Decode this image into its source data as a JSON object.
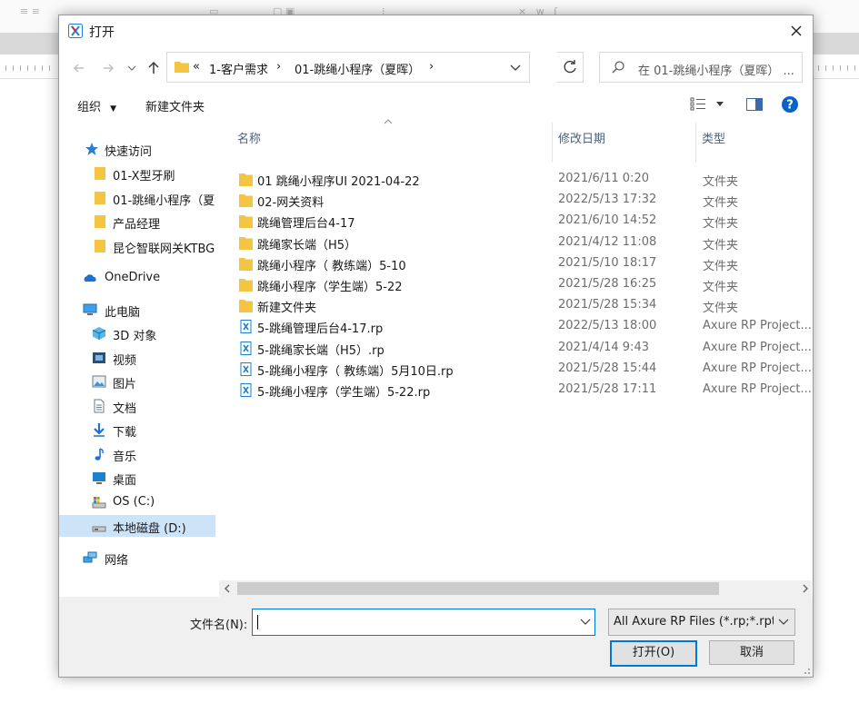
{
  "dialog": {
    "title": "打开",
    "address": {
      "overflow": "«",
      "crumbs": [
        "1-客户需求",
        "01-跳绳小程序（夏晖）"
      ]
    },
    "search_placeholder": "在 01-跳绳小程序（夏晖） ...",
    "toolbar": {
      "organize_label": "组织",
      "new_folder_label": "新建文件夹"
    },
    "nav": {
      "quick_access": "快速访问",
      "pinned": [
        "01-X型牙刷",
        "01-跳绳小程序（夏",
        "产品经理",
        "昆仑智联网关KTBG"
      ],
      "onedrive": "OneDrive",
      "this_pc": "此电脑",
      "pc_items": [
        "3D 对象",
        "视频",
        "图片",
        "文档",
        "下载",
        "音乐",
        "桌面",
        "OS (C:)",
        "本地磁盘 (D:)"
      ],
      "network": "网络"
    },
    "columns": {
      "name": "名称",
      "date": "修改日期",
      "type": "类型"
    },
    "files": [
      {
        "name": "01 跳绳小程序UI 2021-04-22",
        "date": "2021/6/11 0:20",
        "type": "文件夹",
        "kind": "folder"
      },
      {
        "name": "02-网关资料",
        "date": "2022/5/13 17:32",
        "type": "文件夹",
        "kind": "folder"
      },
      {
        "name": "跳绳管理后台4-17",
        "date": "2021/6/10 14:52",
        "type": "文件夹",
        "kind": "folder"
      },
      {
        "name": "跳绳家长端（H5）",
        "date": "2021/4/12 11:08",
        "type": "文件夹",
        "kind": "folder"
      },
      {
        "name": "跳绳小程序（ 教练端）5-10",
        "date": "2021/5/10 18:17",
        "type": "文件夹",
        "kind": "folder"
      },
      {
        "name": "跳绳小程序（学生端）5-22",
        "date": "2021/5/28 16:25",
        "type": "文件夹",
        "kind": "folder"
      },
      {
        "name": "新建文件夹",
        "date": "2021/5/28 15:34",
        "type": "文件夹",
        "kind": "folder"
      },
      {
        "name": "5-跳绳管理后台4-17.rp",
        "date": "2022/5/13 18:00",
        "type": "Axure RP Project...",
        "kind": "axure"
      },
      {
        "name": "5-跳绳家长端（H5）.rp",
        "date": "2021/4/14 9:43",
        "type": "Axure RP Project...",
        "kind": "axure"
      },
      {
        "name": "5-跳绳小程序（ 教练端）5月10日.rp",
        "date": "2021/5/28 15:44",
        "type": "Axure RP Project...",
        "kind": "axure"
      },
      {
        "name": "5-跳绳小程序（学生端）5-22.rp",
        "date": "2021/5/28 17:11",
        "type": "Axure RP Project...",
        "kind": "axure"
      }
    ],
    "footer": {
      "filename_label": "文件名(N):",
      "filename_value": "",
      "filetype": "All Axure RP Files (*.rp;*.rpte",
      "open_label": "打开(O)",
      "cancel_label": "取消"
    }
  },
  "colors": {
    "accent": "#0078d7",
    "folder": "#f4c542",
    "selected": "#cde3f7",
    "axure": "#1f7fd1"
  }
}
